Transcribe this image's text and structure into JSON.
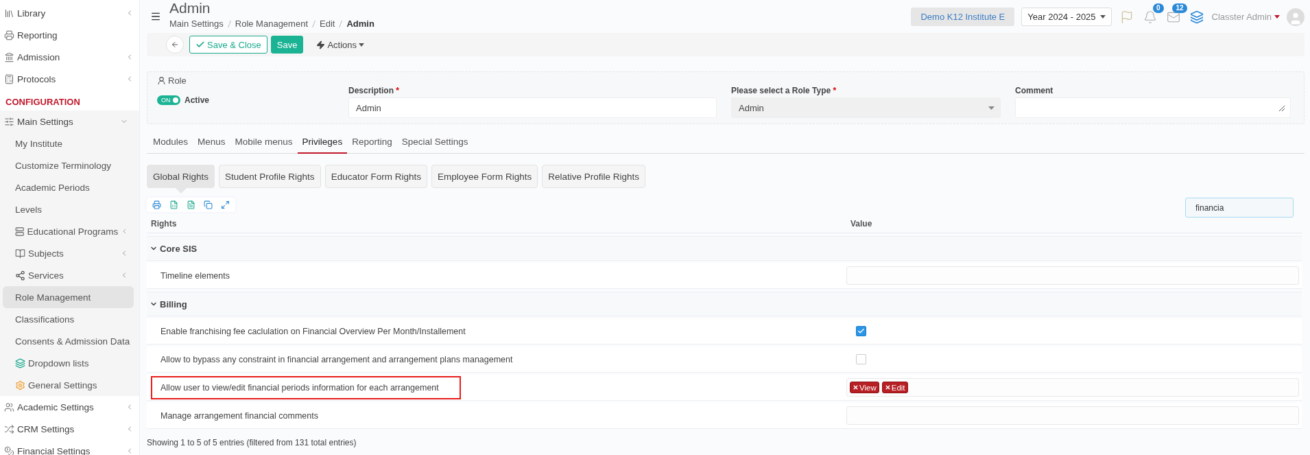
{
  "sidebar": {
    "items": [
      {
        "label": "Library",
        "kind": "item",
        "expanded": false,
        "selected": false
      },
      {
        "label": "Reporting",
        "kind": "item",
        "selected": false
      },
      {
        "label": "Admission",
        "kind": "item",
        "expanded": false,
        "selected": false
      },
      {
        "label": "Protocols",
        "kind": "item",
        "expanded": false,
        "selected": false
      },
      {
        "label": "CONFIGURATION",
        "kind": "heading"
      },
      {
        "label": "Main Settings",
        "kind": "item",
        "expanded": true,
        "selected": false,
        "children": [
          {
            "label": "My Institute",
            "kind": "item",
            "selected": false
          },
          {
            "label": "Customize Terminology",
            "kind": "item",
            "selected": false
          },
          {
            "label": "Academic Periods",
            "kind": "item",
            "selected": false
          },
          {
            "label": "Levels",
            "kind": "item",
            "selected": false
          },
          {
            "label": "Educational Programs",
            "kind": "item",
            "expanded": false,
            "selected": false
          },
          {
            "label": "Subjects",
            "kind": "item",
            "expanded": false,
            "selected": false
          },
          {
            "label": "Services",
            "kind": "item",
            "expanded": false,
            "selected": false
          },
          {
            "label": "Role Management",
            "kind": "item",
            "selected": true
          },
          {
            "label": "Classifications",
            "kind": "item",
            "selected": false
          },
          {
            "label": "Consents & Admission Data",
            "kind": "item",
            "selected": false
          },
          {
            "label": "Dropdown lists",
            "kind": "item",
            "selected": false
          },
          {
            "label": "General Settings",
            "kind": "item",
            "selected": false
          }
        ]
      },
      {
        "label": "Academic Settings",
        "kind": "item",
        "expanded": false,
        "selected": false
      },
      {
        "label": "CRM Settings",
        "kind": "item",
        "expanded": false,
        "selected": false
      },
      {
        "label": "Financial Settings",
        "kind": "item",
        "expanded": false,
        "selected": false
      }
    ]
  },
  "header": {
    "title": "Admin",
    "breadcrumb": [
      {
        "label": "Main Settings",
        "current": false
      },
      {
        "label": "Role Management",
        "current": false
      },
      {
        "label": "Edit",
        "current": false
      },
      {
        "label": "Admin",
        "current": true
      }
    ]
  },
  "top_bar": {
    "institute": "Demo K12 Institute E",
    "year": "Year 2024 - 2025",
    "notifications_badge": "0",
    "messages_badge": "12",
    "user": "Classter Admin"
  },
  "toolbar": {
    "buttons": [
      {
        "label": "Save & Close",
        "kind": "outline"
      },
      {
        "label": "Save",
        "kind": "primary"
      },
      {
        "label": "Actions",
        "kind": "menu"
      }
    ]
  },
  "role_panel": {
    "legend": "Role",
    "toggle": {
      "label": "ON",
      "on": true
    },
    "status": "Active",
    "fields": [
      {
        "label": "Description",
        "required_mark": "*",
        "kind": "input",
        "value": "Admin"
      },
      {
        "label": "Please select a Role Type",
        "required_mark": "*",
        "kind": "select",
        "value": "Admin"
      },
      {
        "label": "Comment",
        "kind": "textarea"
      }
    ]
  },
  "tabs": [
    {
      "label": "Modules",
      "selected": false
    },
    {
      "label": "Menus",
      "selected": false
    },
    {
      "label": "Mobile menus",
      "selected": false
    },
    {
      "label": "Privileges",
      "selected": true
    },
    {
      "label": "Reporting",
      "selected": false
    },
    {
      "label": "Special Settings",
      "selected": false
    }
  ],
  "rights_tabs": [
    {
      "label": "Global Rights",
      "selected": true
    },
    {
      "label": "Student Profile Rights",
      "selected": false
    },
    {
      "label": "Educator Form Rights",
      "selected": false
    },
    {
      "label": "Employee Form Rights",
      "selected": false
    },
    {
      "label": "Relative Profile Rights",
      "selected": false
    }
  ],
  "search": {
    "value": "financia"
  },
  "table": {
    "columns": [
      "Rights",
      "Value"
    ],
    "groups": [
      {
        "label": "Core SIS",
        "expanded": true,
        "rows": [
          {
            "label": "Timeline elements",
            "highlighted": false,
            "value": {
              "kind": "field"
            }
          }
        ]
      },
      {
        "label": "Billing",
        "expanded": true,
        "rows": [
          {
            "label": "Enable franchising fee caclulation on Financial Overview Per Month/Installement",
            "highlighted": false,
            "value": {
              "kind": "checkbox",
              "checked": true
            }
          },
          {
            "label": "Allow to bypass any constraint in financial arrangement and arrangement plans management",
            "highlighted": false,
            "value": {
              "kind": "checkbox",
              "checked": false
            }
          },
          {
            "label": "Allow user to view/edit financial periods information for each arrangement",
            "highlighted": true,
            "value": {
              "kind": "tags",
              "tags": [
                "View",
                "Edit"
              ]
            }
          },
          {
            "label": "Manage arrangement financial comments",
            "highlighted": false,
            "value": {
              "kind": "field"
            }
          }
        ]
      }
    ]
  },
  "footer": "Showing 1 to 5 of 5 entries (filtered from 131 total entries)"
}
